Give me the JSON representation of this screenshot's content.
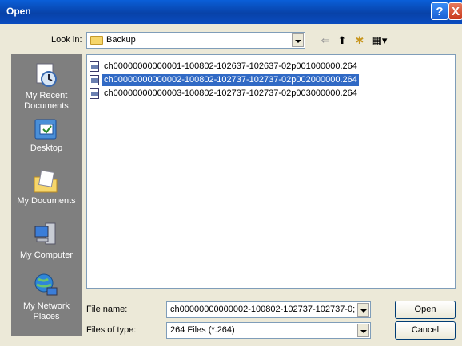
{
  "window": {
    "title": "Open",
    "help_label": "?",
    "close_label": "X"
  },
  "toolbar": {
    "look_in_label": "Look in:",
    "current_folder": "Backup",
    "back_glyph": "⇐",
    "up_glyph": "⬆",
    "new_folder_glyph": "✱",
    "views_glyph": "▦▾"
  },
  "places": [
    {
      "label": "My Recent Documents",
      "icon": "recent-documents-icon"
    },
    {
      "label": "Desktop",
      "icon": "desktop-icon"
    },
    {
      "label": "My Documents",
      "icon": "my-documents-icon"
    },
    {
      "label": "My Computer",
      "icon": "my-computer-icon"
    },
    {
      "label": "My Network Places",
      "icon": "network-places-icon"
    }
  ],
  "files": [
    {
      "name": "ch00000000000001-100802-102637-102637-02p001000000.264",
      "selected": false
    },
    {
      "name": "ch00000000000002-100802-102737-102737-02p002000000.264",
      "selected": true
    },
    {
      "name": "ch00000000000003-100802-102737-102737-02p003000000.264",
      "selected": false
    }
  ],
  "file_name": {
    "label": "File name:",
    "value": "ch00000000000002-100802-102737-102737-0;"
  },
  "file_type": {
    "label": "Files of type:",
    "value": "264 Files (*.264)"
  },
  "buttons": {
    "open": "Open",
    "cancel": "Cancel"
  },
  "colors": {
    "title_bar": "#0a4cc0",
    "selection": "#316ac5",
    "places_bar": "#7f7f7f",
    "dialog": "#ece9d8"
  }
}
